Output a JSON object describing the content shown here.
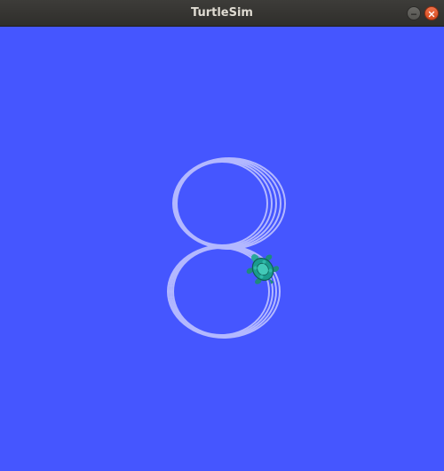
{
  "window": {
    "title": "TurtleSim",
    "minimize_icon": "minimize-icon",
    "close_icon": "close-icon"
  },
  "canvas": {
    "background_color": "#4556ff",
    "path_color": "#b3b8ff",
    "turtle_icon": "turtle-icon"
  }
}
